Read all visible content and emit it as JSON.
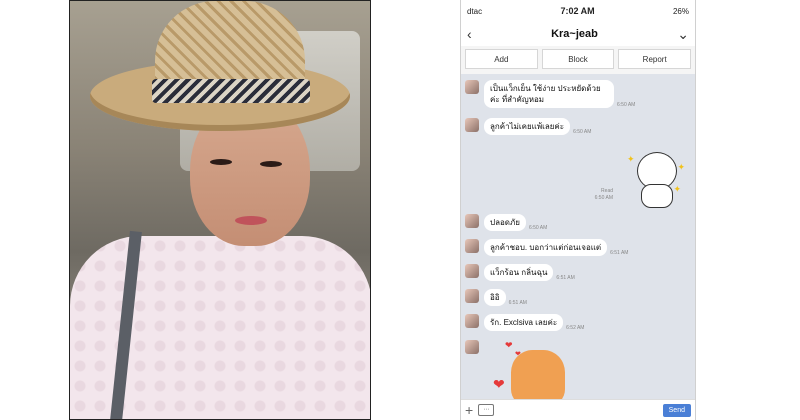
{
  "status_bar": {
    "carrier": "dtac",
    "time": "7:02 AM",
    "battery": "26%"
  },
  "chat_header": {
    "title": "Kra~jeab"
  },
  "actions": {
    "add": "Add",
    "block": "Block",
    "report": "Report"
  },
  "messages": [
    {
      "text": "เป็นแว็กเย็น ใช้ง่าย ประหยัดด้วยค่ะ ที่สำคัญหอม",
      "time": "6:50 AM"
    },
    {
      "text": "ลูกค้าไม่เคยแพ้เลยค่ะ",
      "time": "6:50 AM"
    },
    {
      "text": "ปลอดภัย",
      "time": "6:50 AM"
    },
    {
      "text": "ลูกค้าชอบ. บอกว่าแต่ก่อนเจอแต่",
      "time": "6:51 AM"
    },
    {
      "text": "แว็กร้อน กลิ่นฉุน",
      "time": "6:51 AM"
    },
    {
      "text": "อิอิ",
      "time": "6:51 AM"
    },
    {
      "text": "รัก. Exclsiva เลยค่ะ",
      "time": "6:52 AM"
    }
  ],
  "sent_sticker": {
    "read_label": "Read",
    "time": "6:50 AM"
  },
  "composer": {
    "send_label": "Send"
  },
  "icons": [
    "back-chevron-icon",
    "dropdown-chevron-icon",
    "plus-icon",
    "keyboard-icon"
  ]
}
